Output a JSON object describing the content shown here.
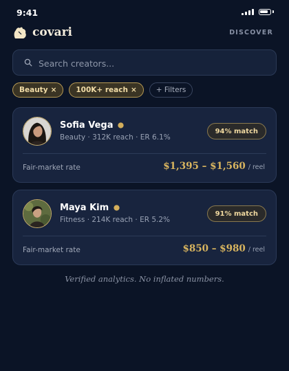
{
  "status_bar": {
    "time": "9:41"
  },
  "header": {
    "brand": "covari",
    "nav_link": "DISCOVER"
  },
  "search": {
    "placeholder": "Search creators..."
  },
  "filters": [
    {
      "label": "Beauty",
      "remove": "×"
    },
    {
      "label": "100K+ reach",
      "remove": "×"
    }
  ],
  "add_filter_label": "+ Filters",
  "creators": [
    {
      "name": "Sofia Vega",
      "meta": "Beauty · 312K reach · ER 6.1%",
      "match": "94% match",
      "rate_label": "Fair-market rate",
      "rate": "$1,395 – $1,560",
      "rate_unit": "/ reel"
    },
    {
      "name": "Maya Kim",
      "meta": "Fitness · 214K reach · ER 5.2%",
      "match": "91% match",
      "rate_label": "Fair-market rate",
      "rate": "$850 – $980",
      "rate_unit": "/ reel"
    }
  ],
  "tagline": "Verified analytics. No inflated numbers.",
  "colors": {
    "background": "#0b1426",
    "card": "#18243e",
    "accent_gold": "#d9b55f"
  }
}
